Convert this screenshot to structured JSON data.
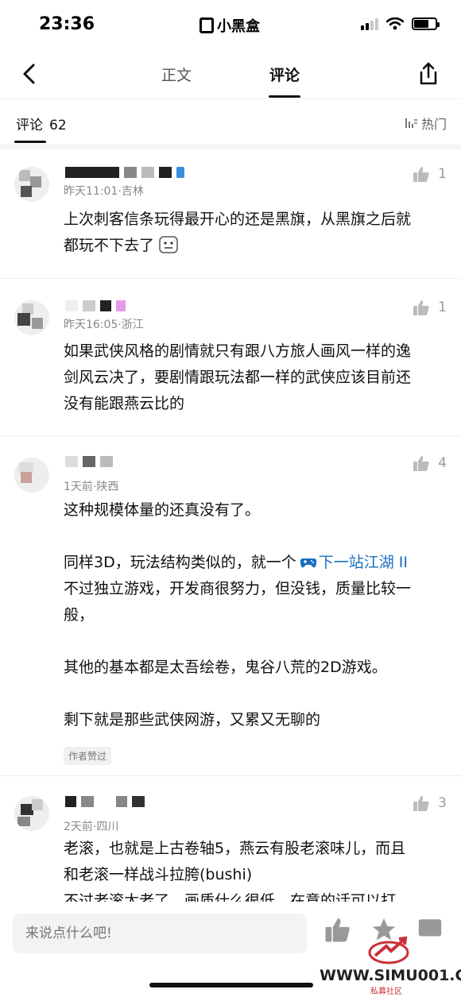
{
  "status": {
    "time": "23:36",
    "app_name": "小黑盒"
  },
  "nav": {
    "tabs": [
      "正文",
      "评论"
    ]
  },
  "sub_header": {
    "label": "评论",
    "count": "62",
    "sort": "热门"
  },
  "comments": [
    {
      "meta": "昨天11:01·吉林",
      "likes": "1",
      "lines": [
        "上次刺客信条玩得最开心的还是黑旗，从黑旗之后就",
        "都玩不下去了"
      ]
    },
    {
      "meta": "昨天16:05·浙江",
      "likes": "1",
      "lines": [
        "如果武侠风格的剧情就只有跟八方旅人画风一样的逸",
        "剑风云决了，要剧情跟玩法都一样的武侠应该目前还",
        "没有能跟燕云比的"
      ]
    },
    {
      "meta": "1天前·陕西",
      "likes": "4",
      "p1": "这种规模体量的还真没有了。",
      "p2_prefix": "同样3D，玩法结构类似的，就一个",
      "game_link": "下一站江湖 II",
      "p2_rest": [
        "不过独立游戏，开发商很努力，但没钱，质量比较一",
        "般，"
      ],
      "p3": "其他的基本都是太吾绘卷，鬼谷八荒的2D游戏。",
      "p4": "剩下就是那些武侠网游，又累又无聊的",
      "badge": "作者赞过"
    },
    {
      "meta": "2天前·四川",
      "likes": "3",
      "lines": [
        "老滚，也就是上古卷轴5，燕云有股老滚味儿，而且",
        "和老滚一样战斗拉胯(bushi)",
        "不过老滚太老了，画质什么很低，在意的话可以打"
      ]
    }
  ],
  "bottom": {
    "placeholder": "来说点什么吧!"
  },
  "watermark": {
    "site": "WWW.SIMU001.CN",
    "sub": "私募社区"
  }
}
